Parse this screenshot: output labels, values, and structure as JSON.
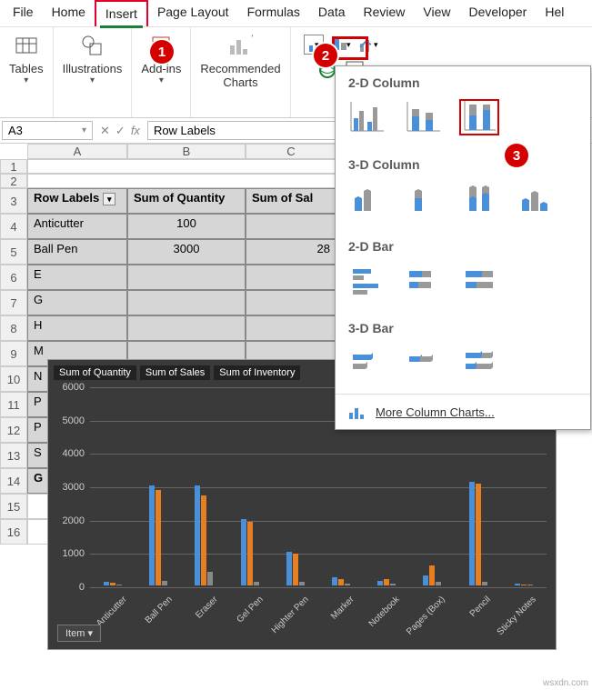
{
  "menubar": [
    "File",
    "Home",
    "Insert",
    "Page Layout",
    "Formulas",
    "Data",
    "Review",
    "View",
    "Developer",
    "Hel"
  ],
  "ribbon": {
    "tables": "Tables",
    "illustrations": "Illustrations",
    "addins": "Add-ins",
    "recommended": "Recommended\nCharts"
  },
  "namebox": "A3",
  "formula": "Row Labels",
  "colheads": [
    "A",
    "B",
    "C"
  ],
  "rowheads": [
    1,
    2,
    3,
    4,
    5,
    6,
    7,
    8,
    9,
    10,
    11,
    12,
    13,
    14,
    15,
    16
  ],
  "table": {
    "headers": [
      "Row Labels",
      "Sum of Quantity",
      "Sum of Sal"
    ],
    "rows": [
      [
        "Anticutter",
        "100",
        ""
      ],
      [
        "Ball Pen",
        "3000",
        "28"
      ],
      [
        "E",
        "",
        "",
        ""
      ],
      [
        "G",
        "",
        "",
        ""
      ],
      [
        "H",
        "",
        "",
        ""
      ],
      [
        "M",
        "",
        "",
        ""
      ],
      [
        "N",
        "",
        "",
        ""
      ],
      [
        "P",
        "",
        "",
        ""
      ],
      [
        "P",
        "",
        "",
        ""
      ],
      [
        "S",
        "",
        "",
        ""
      ],
      [
        "G",
        "",
        "",
        ""
      ]
    ]
  },
  "dropdown": {
    "s2dcol": "2-D Column",
    "s3dcol": "3-D Column",
    "s2dbar": "2-D Bar",
    "s3dbar": "3-D Bar",
    "more": "More Column Charts..."
  },
  "chart_legend": [
    "Sum of Quantity",
    "Sum of Sales",
    "Sum of Inventory"
  ],
  "chart_item": "Item",
  "badges": [
    "1",
    "2",
    "3"
  ],
  "chart_data": {
    "type": "bar",
    "categories": [
      "Anticutter",
      "Ball Pen",
      "Eraser",
      "Gel Pen",
      "Highter Pen",
      "Marker",
      "Notebook",
      "Pages (Box)",
      "Pencil",
      "Sticky Notes"
    ],
    "series": [
      {
        "name": "Sum of Quantity",
        "color": "#4a90d9",
        "values": [
          100,
          3000,
          3000,
          2000,
          1000,
          250,
          150,
          300,
          3100,
          50
        ]
      },
      {
        "name": "Sum of Sales",
        "color": "#e67e22",
        "values": [
          80,
          2870,
          2700,
          1900,
          950,
          200,
          180,
          600,
          3050,
          40
        ]
      },
      {
        "name": "Sum of Inventory",
        "color": "#888888",
        "values": [
          20,
          150,
          400,
          100,
          100,
          50,
          60,
          100,
          100,
          20
        ]
      }
    ],
    "ylim": [
      0,
      6000
    ],
    "ylabel": "",
    "yticks": [
      0,
      1000,
      2000,
      3000,
      4000,
      5000,
      6000
    ]
  }
}
